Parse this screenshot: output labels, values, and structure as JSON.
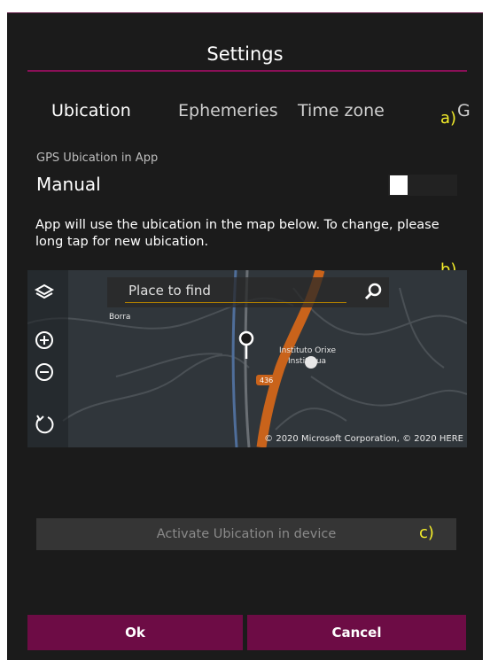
{
  "dialog": {
    "title": "Settings"
  },
  "tabs": [
    {
      "label": "Ubication",
      "active": true
    },
    {
      "label": "Ephemeries",
      "active": false
    },
    {
      "label": "Time zone",
      "active": false
    },
    {
      "label": "G",
      "active": false
    }
  ],
  "annotations": {
    "a": "a)",
    "b": "b)",
    "c": "c)"
  },
  "gps": {
    "section_label": "GPS Ubication in App",
    "mode_value": "Manual",
    "toggle_on": false,
    "description": "App will use the ubication in the map below. To change, please long tap for new ubication."
  },
  "map": {
    "search_placeholder": "Place to find",
    "copyright": "© 2020 Microsoft Corporation, © 2020 HERE",
    "place_label_1": "Instituto Orixe",
    "place_label_2": "Institutua",
    "road_badge": "436",
    "place_left": "Borra"
  },
  "buttons": {
    "activate": "Activate Ubication in device",
    "ok": "Ok",
    "cancel": "Cancel"
  },
  "colors": {
    "accent": "#6d0c45",
    "background": "#1b1b1b",
    "annotation": "#f5ee2a"
  }
}
